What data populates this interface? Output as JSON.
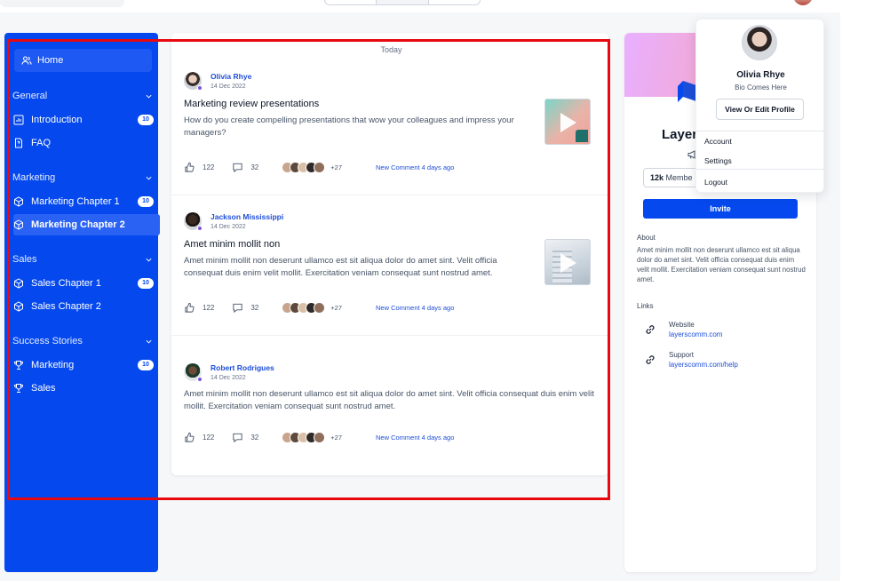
{
  "sidebar": {
    "home": "Home",
    "sections": [
      {
        "title": "General",
        "items": [
          {
            "label": "Introduction",
            "badge": "10"
          },
          {
            "label": "FAQ"
          }
        ]
      },
      {
        "title": "Marketing",
        "items": [
          {
            "label": "Marketing Chapter 1",
            "badge": "10"
          },
          {
            "label": "Marketing Chapter 2"
          }
        ]
      },
      {
        "title": "Sales",
        "items": [
          {
            "label": "Sales Chapter 1",
            "badge": "10"
          },
          {
            "label": "Sales Chapter 2"
          }
        ]
      },
      {
        "title": "Success Stories",
        "items": [
          {
            "label": "Marketing",
            "badge": "10"
          },
          {
            "label": "Sales"
          }
        ]
      }
    ],
    "active_item": "Marketing Chapter 2"
  },
  "feed": {
    "day_label": "Today",
    "posts": [
      {
        "author": "Olivia Rhye",
        "date": "14 Dec 2022",
        "title": "Marketing review presentations",
        "body": "How do you create compelling presentations that wow your colleagues and impress your managers?",
        "likes": "122",
        "comments": "32",
        "more_count": "+27",
        "comment_info": "New Comment 4 days ago"
      },
      {
        "author": "Jackson Mississippi",
        "date": "14 Dec 2022",
        "title": "Amet minim mollit non",
        "body": "Amet minim mollit non deserunt ullamco est sit aliqua dolor do amet sint. Velit officia consequat duis enim velit mollit. Exercitation veniam consequat sunt nostrud amet.",
        "likes": "122",
        "comments": "32",
        "more_count": "+27",
        "comment_info": "New Comment 4 days ago"
      },
      {
        "author": "Robert Rodrigues",
        "date": "14 Dec 2022",
        "body": "Amet minim mollit non deserunt ullamco est sit aliqua dolor do amet sint. Velit officia consequat duis enim velit mollit. Exercitation veniam consequat sunt nostrud amet.",
        "likes": "122",
        "comments": "32",
        "more_count": "+27",
        "comment_info": "New Comment 4 days ago"
      }
    ]
  },
  "community": {
    "name": "Layer",
    "members_count": "12k",
    "members_label": "Membe",
    "invite_label": "Invite",
    "about_heading": "About",
    "about_text": "Amet minim mollit non deserunt ullamco est sit aliqua dolor do amet sint. Velit officia consequat duis enim velit mollit. Exercitation veniam consequat sunt nostrud amet.",
    "links_heading": "Links",
    "links": [
      {
        "label": "Website",
        "url": "layerscomm.com"
      },
      {
        "label": "Support",
        "url": "layerscomm.com/help"
      }
    ]
  },
  "profile_menu": {
    "name": "Olivia Rhye",
    "bio": "Bio Comes Here",
    "edit_button": "View Or Edit Profile",
    "items": [
      "Account",
      "Settings",
      "Logout"
    ]
  },
  "colors": {
    "brand": "#0549ee",
    "link": "#1d4ed8",
    "highlight": "#e8080f"
  }
}
